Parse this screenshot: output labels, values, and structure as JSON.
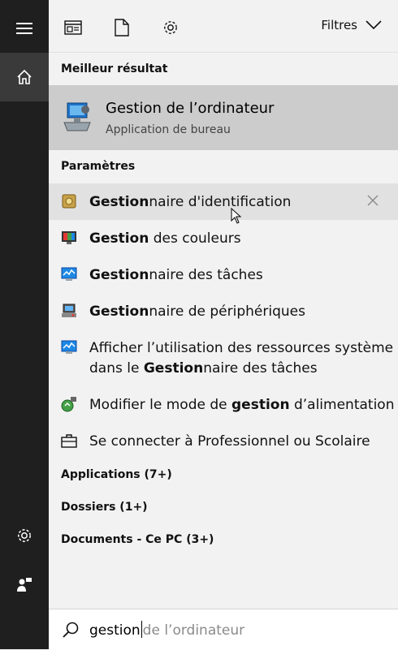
{
  "topbar": {
    "filters_label": "Filtres"
  },
  "best_match": {
    "heading": "Meilleur résultat",
    "title_bold": "Gestion",
    "title_rest": " de l’ordinateur",
    "subtitle": "Application de bureau"
  },
  "settings": {
    "heading": "Paramètres",
    "items": [
      {
        "bold": "Gestion",
        "rest": "naire d'identification"
      },
      {
        "bold": "Gestion",
        "rest": " des couleurs"
      },
      {
        "bold": "Gestion",
        "rest": "naire des tâches"
      },
      {
        "bold": "Gestion",
        "rest": "naire de périphériques"
      },
      {
        "line1": "Afficher l’utilisation des ressources système",
        "line2_pre": "dans le ",
        "line2_bold": "Gestion",
        "line2_rest": "naire des tâches"
      },
      {
        "pre": "Modifier le mode de ",
        "bold": "gestion",
        "rest": " d’alimentation"
      },
      {
        "text": "Se connecter à Professionnel ou Scolaire"
      }
    ]
  },
  "categories": {
    "applications": "Applications (7+)",
    "dossiers": "Dossiers (1+)",
    "documents": "Documents - Ce PC (3+)"
  },
  "search": {
    "typed": "gestion",
    "suggestion": "de l’ordinateur"
  },
  "colors": {
    "rail": "#1f1f1f",
    "best_bg": "#cccccc",
    "hover_bg": "#e1e1e1",
    "panel": "#f2f2f2"
  },
  "icons": [
    "hamburger-menu-icon",
    "home-icon",
    "gear-icon",
    "feedback-icon",
    "apps-view-icon",
    "document-icon",
    "chevron-down-icon",
    "computer-management-icon",
    "credential-manager-icon",
    "color-management-icon",
    "task-manager-icon",
    "device-manager-icon",
    "power-options-icon",
    "briefcase-icon",
    "close-icon",
    "search-icon"
  ]
}
